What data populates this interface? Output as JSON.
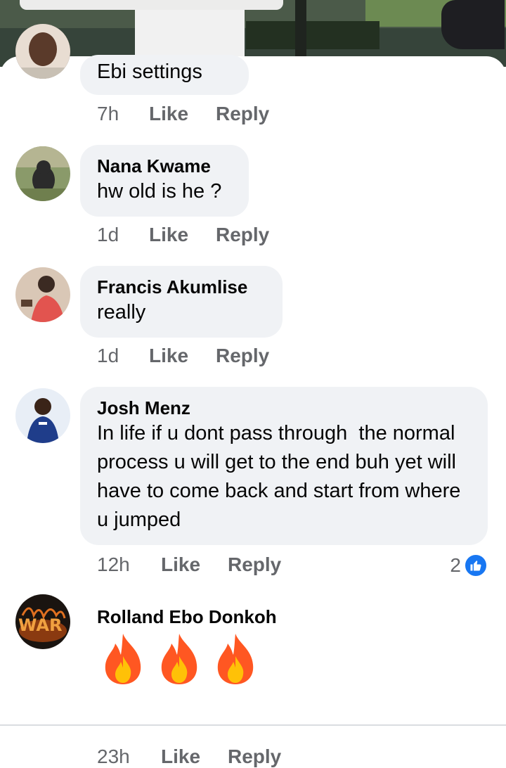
{
  "comments": [
    {
      "author": "",
      "text": "Ebi settings",
      "time": "7h",
      "like_label": "Like",
      "reply_label": "Reply"
    },
    {
      "author": "Nana Kwame",
      "text": "hw old is he ?",
      "time": "1d",
      "like_label": "Like",
      "reply_label": "Reply"
    },
    {
      "author": "Francis Akumlise",
      "text": "really",
      "time": "1d",
      "like_label": "Like",
      "reply_label": "Reply"
    },
    {
      "author": "Josh Menz",
      "text": "In life if u dont pass through  the normal process u will get to the end buh yet will have to come back and start from where u jumped",
      "time": "12h",
      "like_label": "Like",
      "reply_label": "Reply",
      "reaction_count": "2",
      "reaction_icon": "thumbs-up-icon"
    },
    {
      "author": "Rolland Ebo Donkoh",
      "emoji": [
        "fire-icon",
        "fire-icon",
        "fire-icon"
      ],
      "time": "23h",
      "like_label": "Like",
      "reply_label": "Reply"
    }
  ],
  "colors": {
    "bubble": "#f0f2f5",
    "meta_text": "#65676b",
    "like_blue": "#1877f2"
  }
}
